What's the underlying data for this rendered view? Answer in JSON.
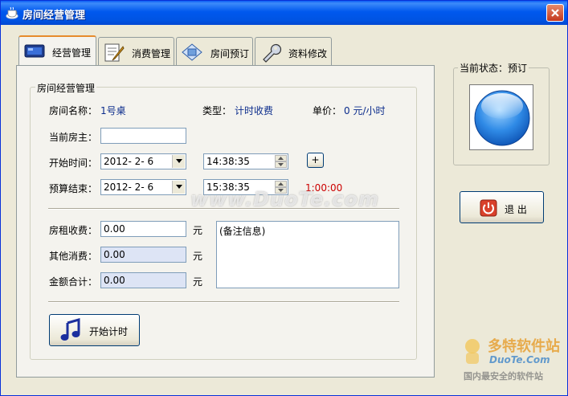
{
  "window": {
    "title": "房间经营管理"
  },
  "tabs": [
    {
      "label": "经营管理",
      "icon": "monitor-icon",
      "active": true
    },
    {
      "label": "消费管理",
      "icon": "notepad-pencil-icon",
      "active": false
    },
    {
      "label": "房间预订",
      "icon": "image-card-icon",
      "active": false
    },
    {
      "label": "资料修改",
      "icon": "wrench-icon",
      "active": false
    }
  ],
  "group": {
    "legend": "房间经营管理"
  },
  "room": {
    "name_label": "房间名称：",
    "name_value": "1号桌",
    "type_label": "类型：",
    "type_value": "计时收费",
    "price_label": "单价：",
    "price_value": "0 元/小时"
  },
  "host": {
    "label": "当前房主：",
    "value": ""
  },
  "start": {
    "label": "开始时间：",
    "date": "2012- 2- 6",
    "time": "14:38:35",
    "plus": "+"
  },
  "end": {
    "label": "预算结束：",
    "date": "2012- 2- 6",
    "time": "15:38:35",
    "duration": "1:00:00"
  },
  "fees": {
    "rent_label": "房租收费：",
    "rent_value": "0.00",
    "other_label": "其他消费：",
    "other_value": "0.00",
    "total_label": "金额合计：",
    "total_value": "0.00",
    "unit": "元"
  },
  "notes": {
    "text": "(备注信息)"
  },
  "start_button": {
    "label": "开始计时",
    "icon": "music-note-icon"
  },
  "status": {
    "label": "当前状态：预订",
    "icon": "blue-orb-icon"
  },
  "exit_button": {
    "label": "退 出",
    "icon": "power-icon"
  },
  "watermark": {
    "center": "www.DuoTe.com",
    "logo_title": "多特软件站",
    "logo_url": "DuoTe.Com",
    "logo_tagline": "国内最安全的软件站"
  },
  "colors": {
    "titlebar": "#0054e3",
    "accent_tab": "#e68b2c",
    "value_text": "#0b2c8c",
    "duration_text": "#cc0000"
  }
}
